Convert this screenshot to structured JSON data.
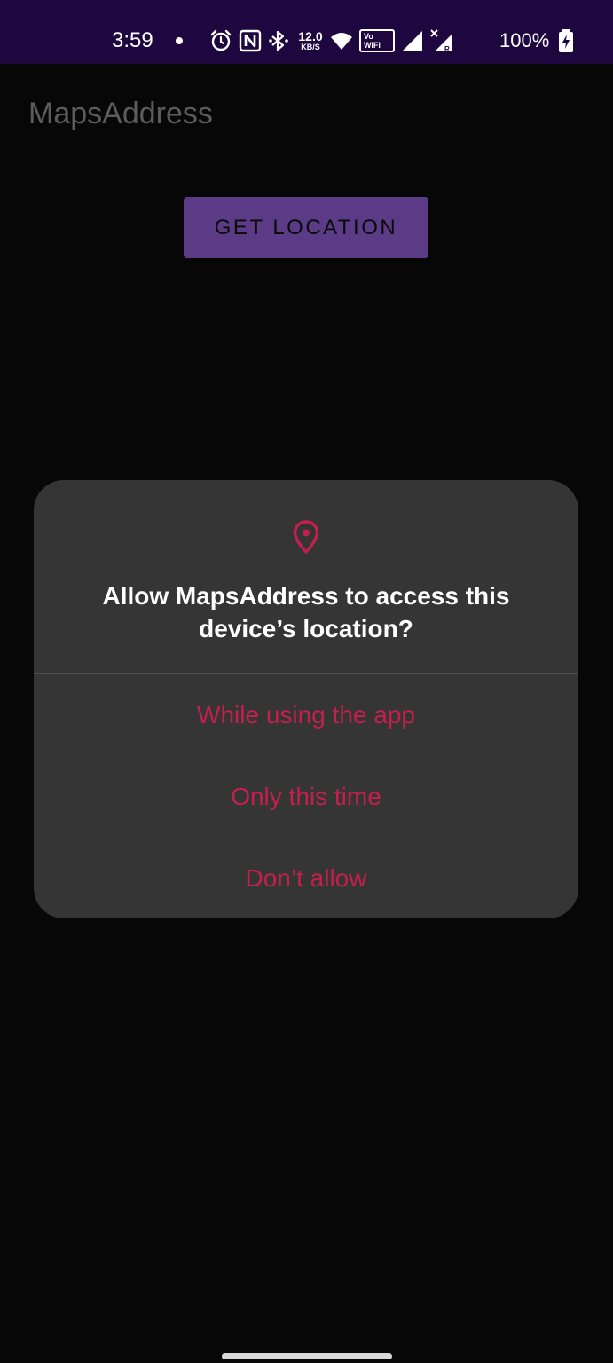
{
  "status_bar": {
    "time": "3:59",
    "network_speed_value": "12.0",
    "network_speed_unit": "KB/S",
    "vowifi_top": "Vo",
    "vowifi_bottom": "WiFi",
    "battery_percent": "100%",
    "icons": [
      "notification-dot-icon",
      "alarm-icon",
      "nfc-icon",
      "bluetooth-icon",
      "wifi-icon",
      "signal-icon",
      "signal-roaming-icon",
      "battery-charging-icon"
    ]
  },
  "app": {
    "title": "MapsAddress",
    "get_location_label": "GET LOCATION",
    "button_color": "#5b3b85",
    "title_color": "#5c5c5c"
  },
  "dialog": {
    "icon": "location-pin-icon",
    "title": "Allow MapsAddress to access this device’s location?",
    "options": [
      {
        "label": "While using the app"
      },
      {
        "label": "Only this time"
      },
      {
        "label": "Don’t allow"
      }
    ],
    "accent_color": "#c41f4e",
    "background_color": "#353535"
  },
  "colors": {
    "status_bar_bg": "#1e063f",
    "screen_bg": "#070707"
  }
}
